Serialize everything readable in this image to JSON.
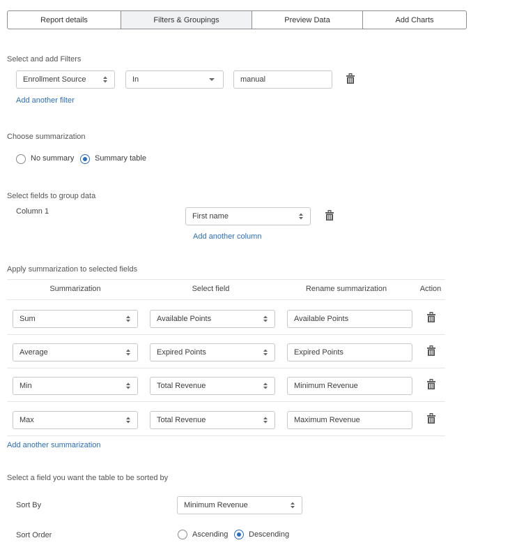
{
  "tabs": [
    {
      "label": "Report details",
      "active": false
    },
    {
      "label": "Filters & Groupings",
      "active": true
    },
    {
      "label": "Preview Data",
      "active": false
    },
    {
      "label": "Add Charts",
      "active": false
    }
  ],
  "filters": {
    "section_label": "Select and add Filters",
    "field": "Enrollment Source",
    "operator": "In",
    "value": "manual",
    "add_link": "Add another filter"
  },
  "summarization_choice": {
    "section_label": "Choose summarization",
    "options": [
      {
        "label": "No summary",
        "checked": false
      },
      {
        "label": "Summary table",
        "checked": true
      }
    ]
  },
  "grouping": {
    "section_label": "Select fields to group data",
    "column_label": "Column 1",
    "column_value": "First name",
    "add_link": "Add another column"
  },
  "summaries": {
    "section_label": "Apply summarization to selected fields",
    "headers": [
      "Summarization",
      "Select field",
      "Rename summarization",
      "Action"
    ],
    "rows": [
      {
        "function": "Sum",
        "field": "Available Points",
        "rename": "Available Points"
      },
      {
        "function": "Average",
        "field": "Expired Points",
        "rename": "Expired Points"
      },
      {
        "function": "Min",
        "field": "Total Revenue",
        "rename": "Minimum Revenue"
      },
      {
        "function": "Max",
        "field": "Total Revenue",
        "rename": "Maximum Revenue"
      }
    ],
    "add_link": "Add another summarization"
  },
  "sorting": {
    "section_label": "Select a field you want the table to be sorted by",
    "sort_by_label": "Sort By",
    "sort_by_value": "Minimum Revenue",
    "sort_order_label": "Sort Order",
    "orders": [
      {
        "label": "Ascending",
        "checked": false
      },
      {
        "label": "Descending",
        "checked": true
      }
    ]
  }
}
